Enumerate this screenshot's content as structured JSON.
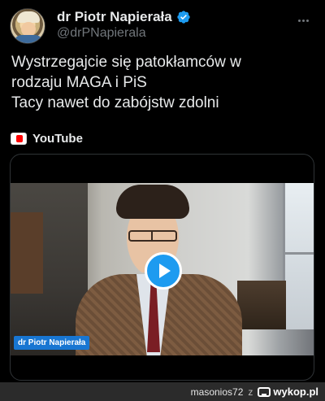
{
  "author": {
    "display_name": "dr Piotr Napierała",
    "handle": "@drPNapierala",
    "avatar_icon": "avatar-photo",
    "verified_color": "#1d9bf0"
  },
  "tweet": {
    "text_lines": [
      "Wystrzegajcie się patokłamców w",
      "rodzaju MAGA i PiS",
      "Tacy nawet do zabójstw zdolni"
    ]
  },
  "source": {
    "label": "YouTube",
    "icon": "youtube-icon"
  },
  "video": {
    "channel_tag": "dr Piotr Napierała",
    "play_icon": "play-icon",
    "play_color": "#1d9bf0"
  },
  "footer": {
    "username": "masonios72",
    "separator": "z",
    "site": "wykop.pl"
  }
}
